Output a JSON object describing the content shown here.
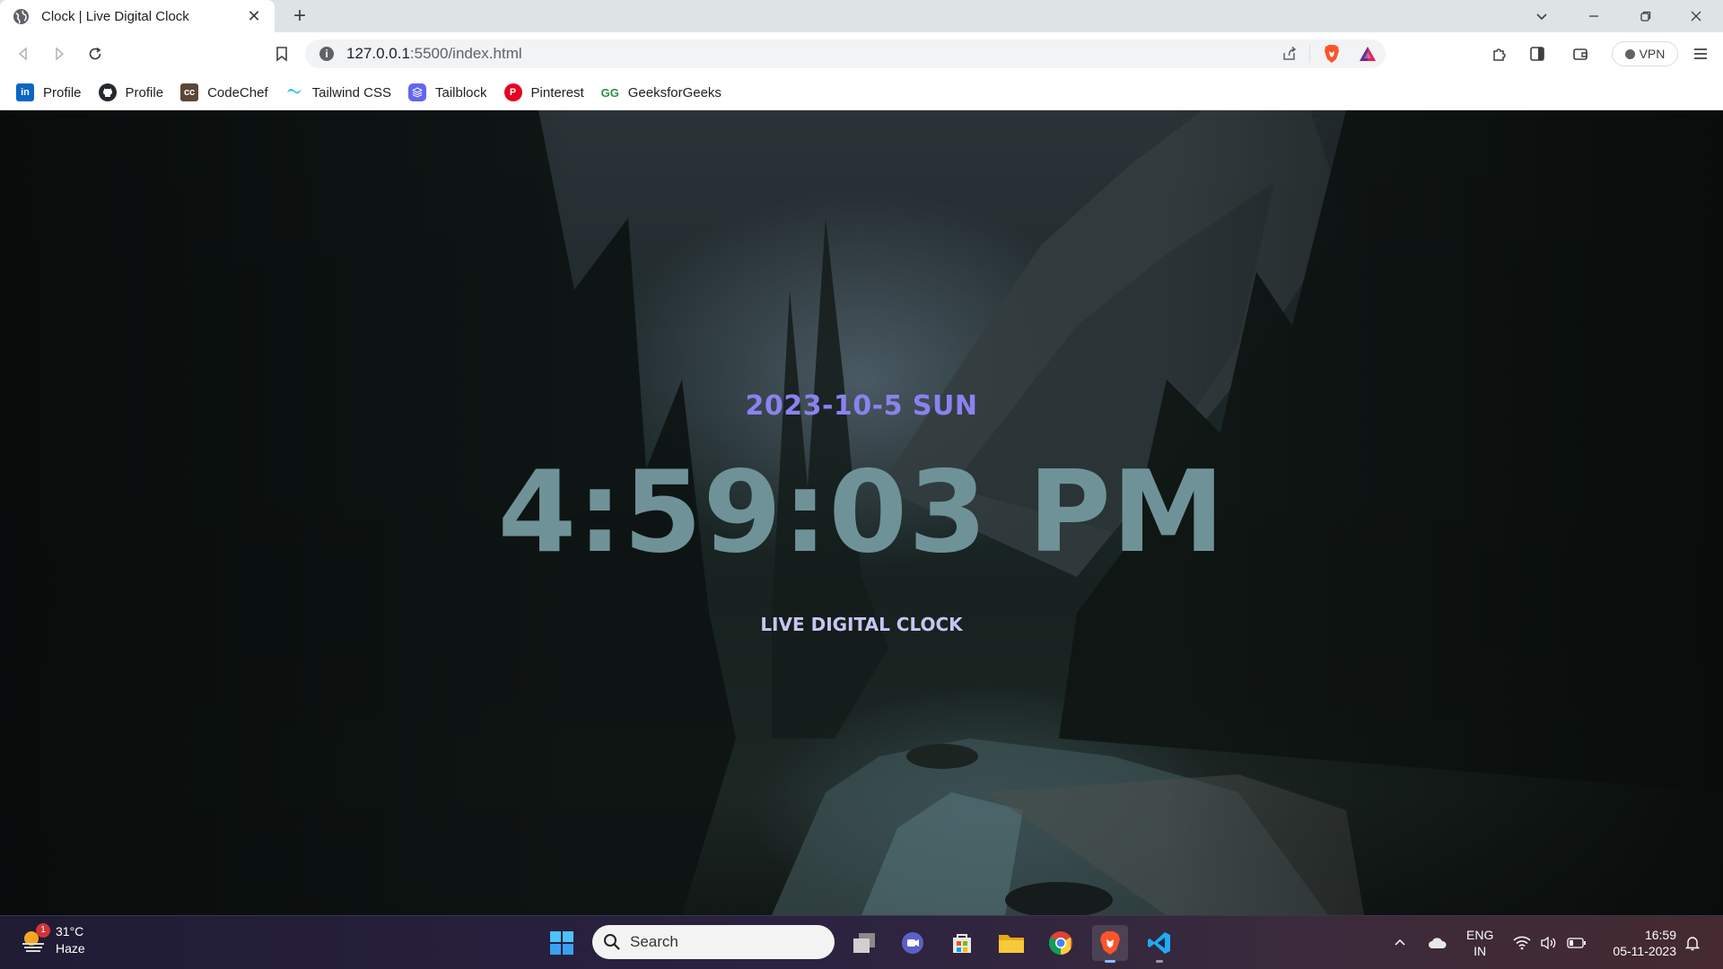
{
  "browser": {
    "tab_title": "Clock | Live Digital Clock",
    "url_host": "127.0.0.1",
    "url_path": ":5500/index.html",
    "vpn_label": "VPN"
  },
  "bookmarks": [
    {
      "label": "Profile",
      "icon": "linkedin-icon",
      "color": "#0a66c2"
    },
    {
      "label": "Profile",
      "icon": "github-icon",
      "color": "#24292f"
    },
    {
      "label": "CodeChef",
      "icon": "codechef-icon",
      "color": "#5b4638"
    },
    {
      "label": "Tailwind CSS",
      "icon": "tailwind-icon",
      "color": "#38bdf8"
    },
    {
      "label": "Tailblock",
      "icon": "tailblock-icon",
      "color": "#6366f1"
    },
    {
      "label": "Pinterest",
      "icon": "pinterest-icon",
      "color": "#e60023"
    },
    {
      "label": "GeeksforGeeks",
      "icon": "geeksforgeeks-icon",
      "color": "#2f8d46"
    }
  ],
  "clock": {
    "date": "2023-10-5 SUN",
    "time": "4:59:03 PM",
    "label": "LIVE DIGITAL CLOCK",
    "date_color": "#8b82f0",
    "time_color": "#6f9298",
    "label_color": "#c8c5f5"
  },
  "taskbar": {
    "weather_temp": "31°C",
    "weather_desc": "Haze",
    "weather_badge": "1",
    "search_placeholder": "Search",
    "lang_top": "ENG",
    "lang_bottom": "IN",
    "time": "16:59",
    "date": "05-11-2023"
  }
}
